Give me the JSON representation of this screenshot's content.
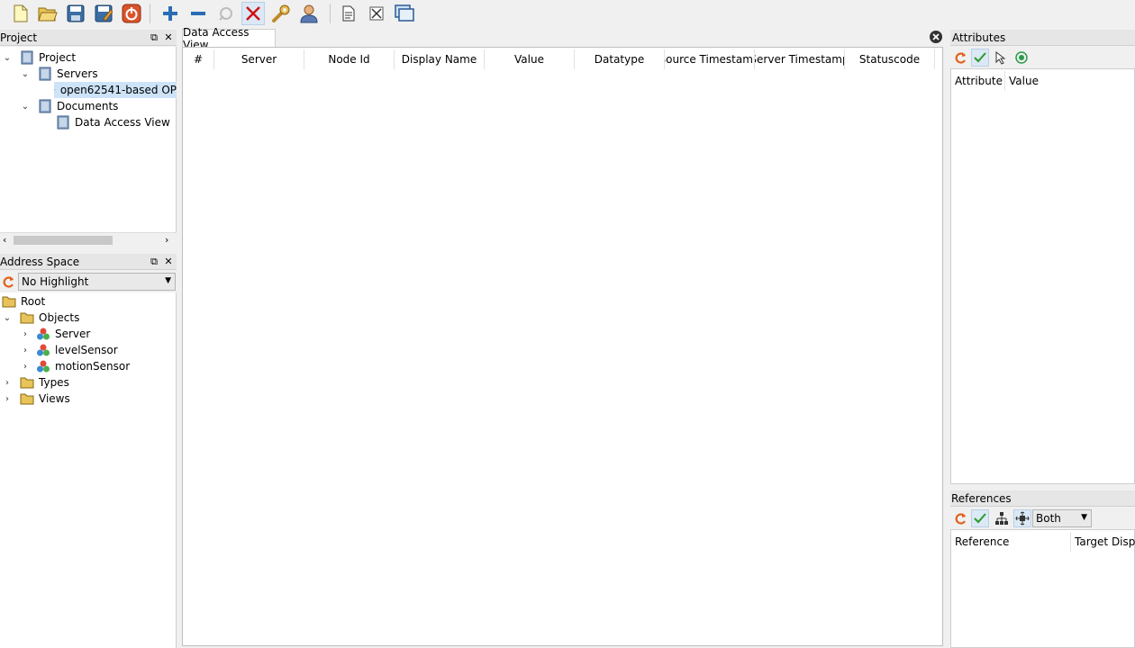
{
  "project_panel": {
    "title": "Project",
    "tree": [
      {
        "label": "Project"
      },
      {
        "label": "Servers"
      },
      {
        "label": "open62541-based OP"
      },
      {
        "label": "Documents"
      },
      {
        "label": "Data Access View"
      }
    ]
  },
  "address_panel": {
    "title": "Address Space",
    "highlight_value": "No Highlight",
    "tree": [
      {
        "label": "Root"
      },
      {
        "label": "Objects"
      },
      {
        "label": "Server"
      },
      {
        "label": "levelSensor"
      },
      {
        "label": "motionSensor"
      },
      {
        "label": "Types"
      },
      {
        "label": "Views"
      }
    ]
  },
  "main": {
    "tab_label": "Data Access View",
    "columns": [
      "#",
      "Server",
      "Node Id",
      "Display Name",
      "Value",
      "Datatype",
      "Source Timestamp",
      "Server Timestamp",
      "Statuscode"
    ]
  },
  "attributes_panel": {
    "title": "Attributes",
    "columns": [
      "Attribute",
      "Value"
    ]
  },
  "references_panel": {
    "title": "References",
    "direction_value": "Both",
    "columns": [
      "Reference",
      "Target Display"
    ]
  },
  "colors": {
    "accent": "#3a6ea5",
    "selection": "#cde3f7",
    "folder": "#e8c35a"
  }
}
